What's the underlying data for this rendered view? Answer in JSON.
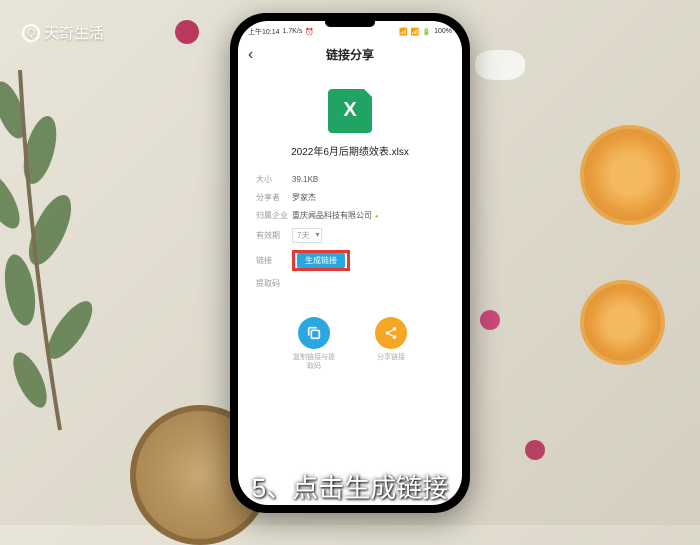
{
  "watermark": {
    "icon_text": "Q",
    "text": "天奇生活"
  },
  "status": {
    "time": "上午10:14",
    "speed": "1.7K/s",
    "battery": "100%"
  },
  "nav": {
    "title": "链接分享"
  },
  "file": {
    "icon_letter": "X",
    "name": "2022年6月后期绩效表.xlsx"
  },
  "meta": {
    "size_label": "大小",
    "size_value": "39.1KB",
    "sharer_label": "分享者",
    "sharer_value": "罗家杰",
    "org_label": "归属企业",
    "org_value": "重庆闻品科技有限公司",
    "expire_label": "有效期",
    "expire_value": "7天",
    "link_label": "链接",
    "gen_link": "生成链接",
    "extract_label": "提取码"
  },
  "actions": {
    "copy": {
      "label_line1": "复制链接与提",
      "label_line2": "取码"
    },
    "share": {
      "label": "分享链接"
    }
  },
  "caption": "5、点击生成链接"
}
